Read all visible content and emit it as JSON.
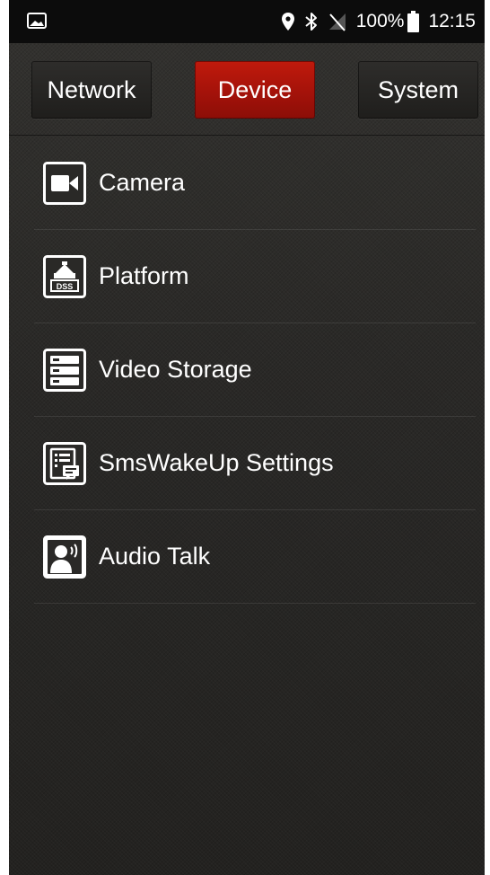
{
  "status_bar": {
    "left_icon": "image-notification-icon",
    "location_icon": "location-pin-icon",
    "bluetooth_icon": "bluetooth-icon",
    "signal_icon": "no-signal-icon",
    "battery": "100%",
    "time": "12:15"
  },
  "tabs": [
    {
      "label": "Network",
      "selected": false
    },
    {
      "label": "Device",
      "selected": true
    },
    {
      "label": "System",
      "selected": false
    }
  ],
  "menu": {
    "items": [
      {
        "label": "Camera",
        "icon": "camera-icon"
      },
      {
        "label": "Platform",
        "icon": "dss-platform-icon"
      },
      {
        "label": "Video Storage",
        "icon": "storage-icon"
      },
      {
        "label": "SmsWakeUp Settings",
        "icon": "sms-wakeup-icon"
      },
      {
        "label": "Audio Talk",
        "icon": "audio-talk-icon"
      }
    ]
  },
  "colors": {
    "accent": "#b3150b",
    "background": "#2b2a28",
    "status_bar": "#0c0c0c",
    "text": "#ffffff"
  }
}
